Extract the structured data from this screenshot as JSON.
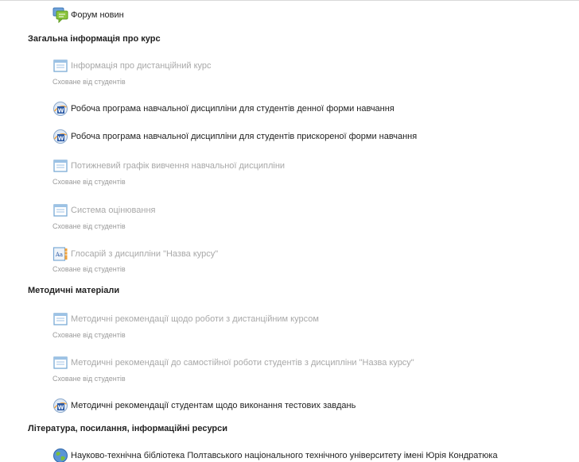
{
  "items": [
    {
      "kind": "activity",
      "icon": "forum-icon",
      "label": "Форум новин",
      "dimmed": false
    },
    {
      "kind": "section",
      "label": "Загальна інформація про курс"
    },
    {
      "kind": "activity",
      "icon": "page-icon",
      "label": "Інформація про дистанційний курс",
      "dimmed": true,
      "note": "Сховане від студентів"
    },
    {
      "kind": "activity",
      "icon": "word-document-icon",
      "label": "Робоча програма навчальної дисципліни для студентів денної форми навчання",
      "dimmed": false
    },
    {
      "kind": "activity",
      "icon": "word-document-icon",
      "label": "Робоча програма навчальної дисципліни для студентів прискореної форми навчання",
      "dimmed": false
    },
    {
      "kind": "activity",
      "icon": "page-icon",
      "label": "Потижневий графік вивчення навчальної дисципліни",
      "dimmed": true,
      "note": "Сховане від студентів"
    },
    {
      "kind": "activity",
      "icon": "page-icon",
      "label": "Система оцінювання",
      "dimmed": true,
      "note": "Сховане від студентів"
    },
    {
      "kind": "activity",
      "icon": "glossary-icon",
      "label": "Глосарій з дисципліни \"Назва курсу\"",
      "dimmed": true,
      "note": "Сховане від студентів"
    },
    {
      "kind": "section",
      "label": "Методичні матеріали"
    },
    {
      "kind": "activity",
      "icon": "page-icon",
      "label": "Методичні рекомендації щодо роботи з дистанційним курсом",
      "dimmed": true,
      "note": "Сховане від студентів"
    },
    {
      "kind": "activity",
      "icon": "page-icon",
      "label": "Методичні рекомендації до самостійної роботи студентів з дисципліни \"Назва курсу\"",
      "dimmed": true,
      "note": "Сховане від студентів"
    },
    {
      "kind": "activity",
      "icon": "word-document-icon",
      "label": "Методичні рекомендації студентам щодо виконання тестових завдань",
      "dimmed": false
    },
    {
      "kind": "section",
      "label": "Література, посилання, інформаційні ресурси"
    },
    {
      "kind": "activity",
      "icon": "url-globe-icon",
      "label": "Науково-технічна бібліотека Полтавського національного технічного університету імені Юрія Кондратюка",
      "dimmed": false
    }
  ]
}
